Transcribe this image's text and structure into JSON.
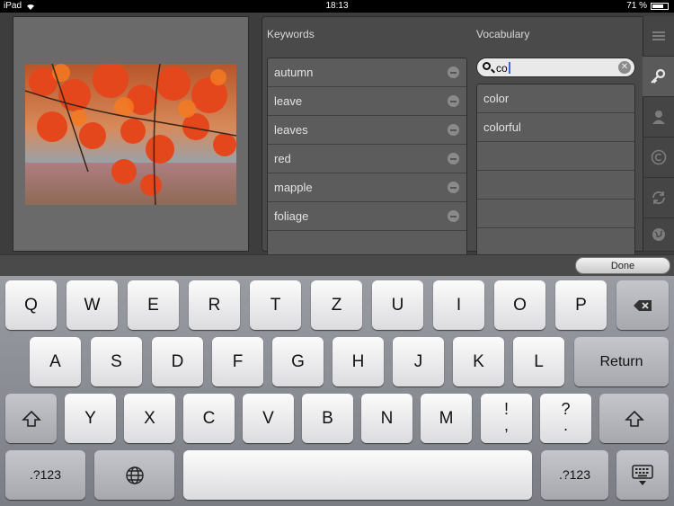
{
  "status": {
    "device": "iPad",
    "time": "18:13",
    "battery": "71 %"
  },
  "keywords": {
    "title": "Keywords",
    "items": [
      "autumn",
      "leave",
      "leaves",
      "red",
      "mapple",
      "foliage"
    ]
  },
  "vocabulary": {
    "title": "Vocabulary",
    "search_value": "co",
    "items": [
      "color",
      "colorful"
    ]
  },
  "done_label": "Done",
  "keyboard": {
    "row1": [
      "Q",
      "W",
      "E",
      "R",
      "T",
      "Z",
      "U",
      "I",
      "O",
      "P"
    ],
    "row2": [
      "A",
      "S",
      "D",
      "F",
      "G",
      "H",
      "J",
      "K",
      "L"
    ],
    "return_label": "Return",
    "row3": [
      "Y",
      "X",
      "C",
      "V",
      "B",
      "N",
      "M"
    ],
    "excl_top": "!",
    "excl_bottom": ",",
    "quest_top": "?",
    "quest_bottom": ".",
    "numbers_label": ".?123"
  },
  "icons": {
    "sidebar": [
      "list-icon",
      "key-icon",
      "person-icon",
      "copyright-icon",
      "sync-icon",
      "globe-icon"
    ]
  }
}
